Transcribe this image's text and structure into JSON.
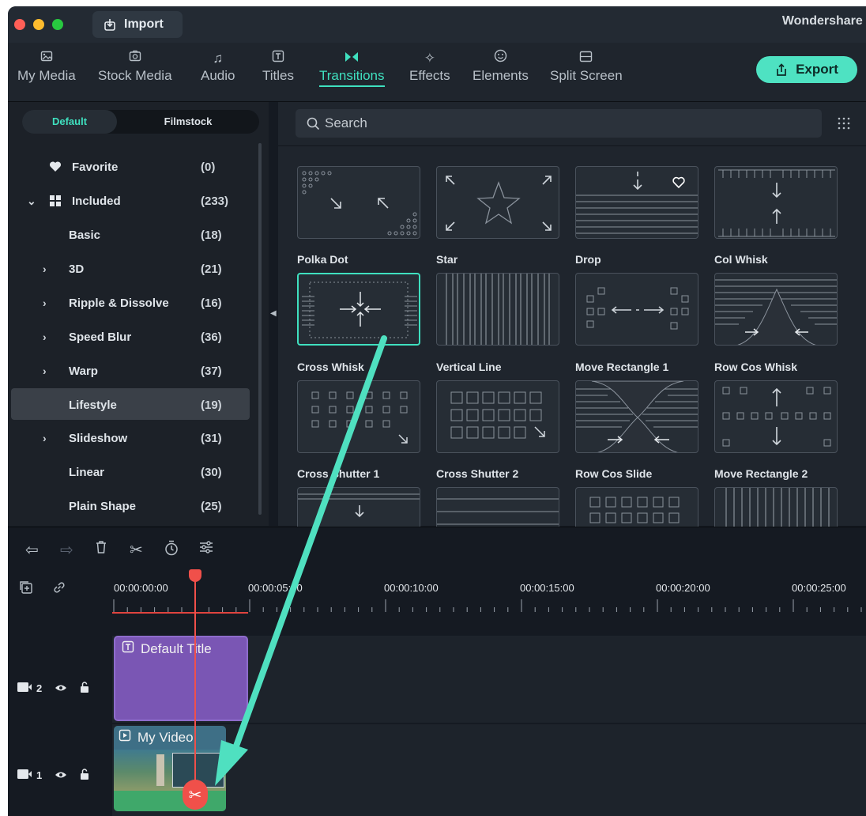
{
  "window": {
    "title": "Wondershare F",
    "import_label": "Import"
  },
  "toolbar": {
    "items": [
      {
        "label": "My Media",
        "icon": "image-icon"
      },
      {
        "label": "Stock Media",
        "icon": "stock-media-icon"
      },
      {
        "label": "Audio",
        "icon": "music-note-icon"
      },
      {
        "label": "Titles",
        "icon": "text-t-icon"
      },
      {
        "label": "Transitions",
        "icon": "transition-bowtie-icon",
        "active": true
      },
      {
        "label": "Effects",
        "icon": "sparkle-icon"
      },
      {
        "label": "Elements",
        "icon": "smiley-icon"
      },
      {
        "label": "Split Screen",
        "icon": "split-screen-icon"
      }
    ],
    "export_label": "Export"
  },
  "library": {
    "tabs": [
      "Default",
      "Filmstock"
    ],
    "categories": [
      {
        "name": "Favorite",
        "count": "(0)",
        "icon": "heart-icon"
      },
      {
        "name": "Included",
        "count": "(233)",
        "icon": "grid-icon",
        "expanded": true
      },
      {
        "name": "Basic",
        "count": "(18)"
      },
      {
        "name": "3D",
        "count": "(21)",
        "has_children": true
      },
      {
        "name": "Ripple & Dissolve",
        "count": "(16)",
        "has_children": true
      },
      {
        "name": "Speed Blur",
        "count": "(36)",
        "has_children": true
      },
      {
        "name": "Warp",
        "count": "(37)",
        "has_children": true
      },
      {
        "name": "Lifestyle",
        "count": "(19)",
        "selected": true
      },
      {
        "name": "Slideshow",
        "count": "(31)",
        "has_children": true
      },
      {
        "name": "Linear",
        "count": "(30)"
      },
      {
        "name": "Plain Shape",
        "count": "(25)"
      }
    ]
  },
  "search": {
    "placeholder": "Search"
  },
  "transitions": [
    {
      "name": "Polka Dot"
    },
    {
      "name": "Star"
    },
    {
      "name": "Drop"
    },
    {
      "name": "Col Whisk"
    },
    {
      "name": "Cross Whisk",
      "selected": true
    },
    {
      "name": "Vertical Line"
    },
    {
      "name": "Move Rectangle 1"
    },
    {
      "name": "Row Cos Whisk"
    },
    {
      "name": "Cross Shutter 1"
    },
    {
      "name": "Cross Shutter 2"
    },
    {
      "name": "Row Cos Slide"
    },
    {
      "name": "Move Rectangle 2"
    }
  ],
  "timeline": {
    "ruler_labels": [
      "00:00:00:00",
      "00:00:05:00",
      "00:00:10:00",
      "00:00:15:00",
      "00:00:20:00",
      "00:00:25:00"
    ],
    "tracks": [
      {
        "number": "2",
        "clip_label": "Default Title",
        "clip_type": "title"
      },
      {
        "number": "1",
        "clip_label": "My Video",
        "clip_type": "video"
      }
    ]
  },
  "colors": {
    "accent": "#3fe0bf",
    "playhead": "#f0504a",
    "title_clip": "#7a56b4",
    "video_clip": "#2a6a56",
    "annotation_arrow": "#4fe0c0"
  }
}
